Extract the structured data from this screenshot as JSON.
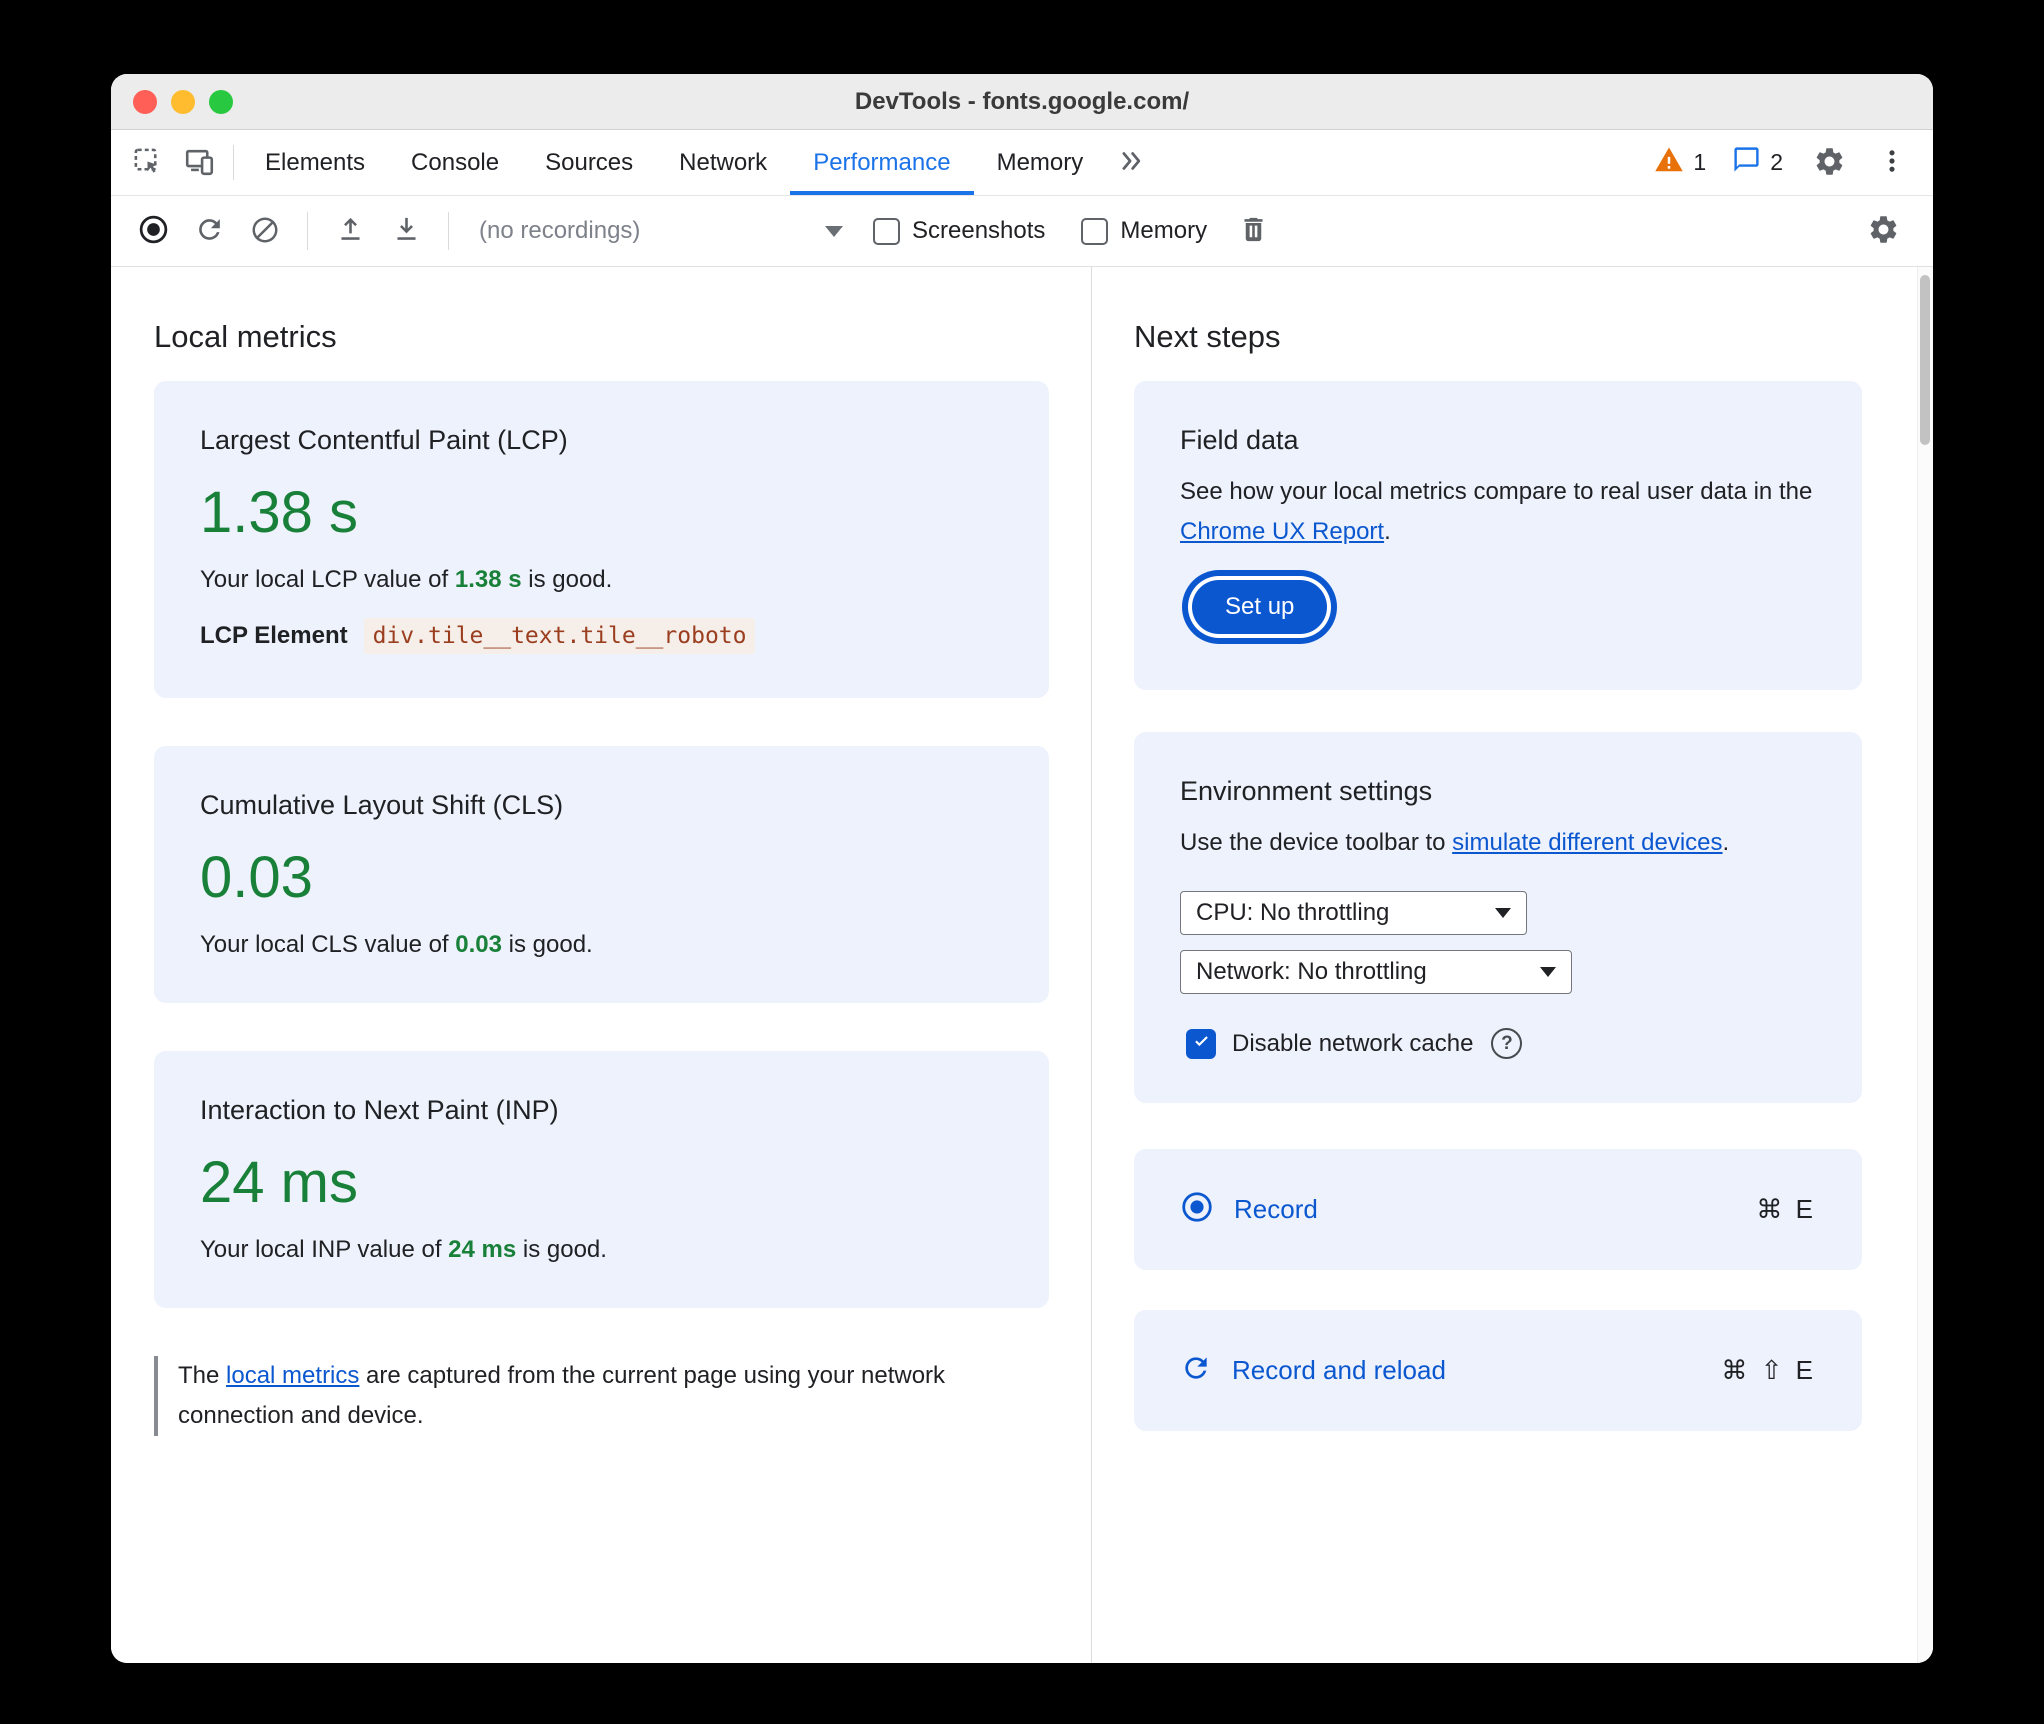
{
  "colors": {
    "accent_blue": "#0b57d0",
    "tab_active_blue": "#1a73e8",
    "metric_green": "#188038",
    "warning_orange": "#e8710a",
    "card_background": "#edf2fc",
    "code_text": "#9b3e20",
    "traffic_red": "#ff5f57",
    "traffic_yellow": "#febc2e",
    "traffic_green": "#28c840"
  },
  "window": {
    "title": "DevTools - fonts.google.com/"
  },
  "tabbar": {
    "tabs": [
      {
        "label": "Elements"
      },
      {
        "label": "Console"
      },
      {
        "label": "Sources"
      },
      {
        "label": "Network"
      },
      {
        "label": "Performance"
      },
      {
        "label": "Memory"
      }
    ],
    "active_tab": "Performance",
    "warning_count": "1",
    "issues_count": "2"
  },
  "toolbar": {
    "recordings_dropdown": "(no recordings)",
    "screenshots": {
      "label": "Screenshots",
      "checked": false
    },
    "memory": {
      "label": "Memory",
      "checked": false
    }
  },
  "local_metrics": {
    "heading": "Local metrics",
    "lcp": {
      "title": "Largest Contentful Paint (LCP)",
      "value": "1.38 s",
      "desc_before": "Your local LCP value of ",
      "desc_value": "1.38 s",
      "desc_after": " is good.",
      "element_label": "LCP Element",
      "element_selector": "div.tile__text.tile__roboto"
    },
    "cls": {
      "title": "Cumulative Layout Shift (CLS)",
      "value": "0.03",
      "desc_before": "Your local CLS value of ",
      "desc_value": "0.03",
      "desc_after": " is good."
    },
    "inp": {
      "title": "Interaction to Next Paint (INP)",
      "value": "24 ms",
      "desc_before": "Your local INP value of ",
      "desc_value": "24 ms",
      "desc_after": " is good."
    },
    "note_before": "The ",
    "note_link": "local metrics",
    "note_after": " are captured from the current page using your network connection and device."
  },
  "next_steps": {
    "heading": "Next steps",
    "field_data": {
      "title": "Field data",
      "body_before": "See how your local metrics compare to real user data in the ",
      "body_link": "Chrome UX Report",
      "body_after": ".",
      "button": "Set up"
    },
    "environment": {
      "title": "Environment settings",
      "body_before": "Use the device toolbar to ",
      "body_link": "simulate different devices",
      "body_after": ".",
      "cpu_select": "CPU: No throttling",
      "network_select": "Network: No throttling",
      "cache_checkbox": "Disable network cache"
    },
    "record": {
      "label": "Record",
      "shortcut": "⌘ E"
    },
    "record_reload": {
      "label": "Record and reload",
      "shortcut": "⌘ ⇧ E"
    }
  },
  "icons": {
    "help": "?"
  }
}
